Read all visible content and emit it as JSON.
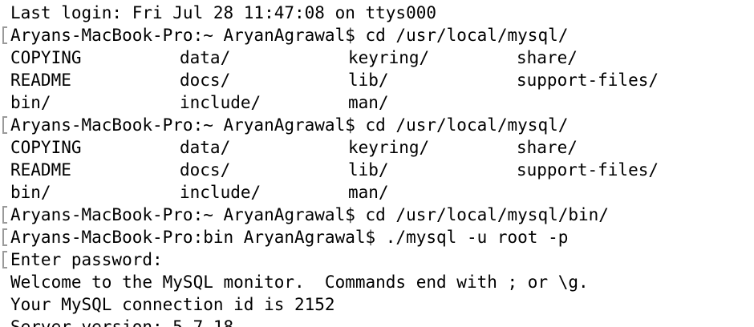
{
  "terminal": {
    "last_login": "Last login: Fri Jul 28 11:47:08 on ttys000",
    "cmd1": "Aryans-MacBook-Pro:~ AryanAgrawal$ cd /usr/local/mysql/",
    "listing1": [
      [
        "COPYING",
        "data/",
        "keyring/",
        "share/"
      ],
      [
        "README",
        "docs/",
        "lib/",
        "support-files/"
      ],
      [
        "bin/",
        "include/",
        "man/",
        ""
      ]
    ],
    "cmd2": "Aryans-MacBook-Pro:~ AryanAgrawal$ cd /usr/local/mysql/",
    "listing2": [
      [
        "COPYING",
        "data/",
        "keyring/",
        "share/"
      ],
      [
        "README",
        "docs/",
        "lib/",
        "support-files/"
      ],
      [
        "bin/",
        "include/",
        "man/",
        ""
      ]
    ],
    "cmd3": "Aryans-MacBook-Pro:~ AryanAgrawal$ cd /usr/local/mysql/bin/",
    "cmd4": "Aryans-MacBook-Pro:bin AryanAgrawal$ ./mysql -u root -p",
    "enter_password": "Enter password:",
    "welcome": "Welcome to the MySQL monitor.  Commands end with ; or \\g.",
    "connection_id": "Your MySQL connection id is 2152",
    "server_version": "Server version: 5.7.18"
  }
}
